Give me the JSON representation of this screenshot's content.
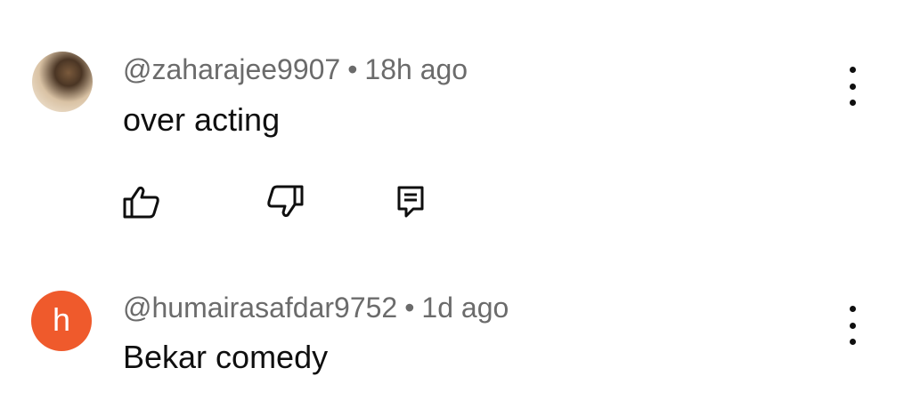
{
  "comments": [
    {
      "handle": "@zaharajee9907",
      "separator": "•",
      "time": "18h ago",
      "text": "over acting",
      "avatar_type": "photo"
    },
    {
      "handle": "@humairasafdar9752",
      "separator": "•",
      "time": "1d ago",
      "text": "Bekar comedy",
      "avatar_letter": "h",
      "avatar_color": "#ef5a2c"
    }
  ],
  "icons": {
    "like": "thumb-up-icon",
    "dislike": "thumb-down-icon",
    "reply": "reply-icon",
    "menu": "more-vert-icon"
  }
}
